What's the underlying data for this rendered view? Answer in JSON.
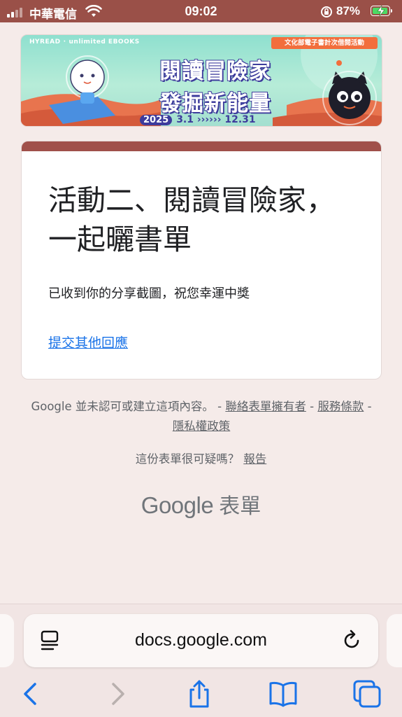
{
  "status_bar": {
    "carrier": "中華電信",
    "time": "09:02",
    "battery": "87%"
  },
  "banner": {
    "brand": "HYREAD",
    "brand_partner": "unlimited EBOOKS",
    "tag": "文化部電子書計次借閱活動",
    "title_line1": "閱讀冒險家",
    "title_line2": "發掘新能量",
    "year": "2025",
    "date_range": "3.1 ›››››› 12.31"
  },
  "form": {
    "title": "活動二、閱讀冒險家，一起曬書單",
    "response_message": "已收到你的分享截圖，祝您幸運中獎",
    "submit_another_link": "提交其他回應"
  },
  "footer": {
    "disclaimer": "Google 並未認可或建立這項內容。 -",
    "contact_owner": "聯絡表單擁有者",
    "sep1": "-",
    "terms": "服務條款",
    "sep2": "-",
    "privacy": "隱私權政策",
    "suspicious_question": "這份表單很可疑嗎？",
    "report": "報告",
    "logo_google": "Google",
    "logo_product": "表單"
  },
  "browser": {
    "url": "docs.google.com"
  },
  "colors": {
    "status_bar": "#9a5048",
    "form_accent": "#a0504a",
    "page_bg": "#f5ebe9",
    "link": "#1a73e8",
    "ios_blue": "#1a73e8"
  },
  "icons": {
    "signal": "signal-icon",
    "wifi": "wifi-icon",
    "orientation_lock": "orientation-lock-icon",
    "battery": "battery-charging-icon",
    "reader": "reader-mode-icon",
    "reload": "reload-icon",
    "back": "back-chevron-icon",
    "forward": "forward-chevron-icon",
    "share": "share-icon",
    "bookmarks": "bookmarks-icon",
    "tabs": "tabs-icon"
  }
}
